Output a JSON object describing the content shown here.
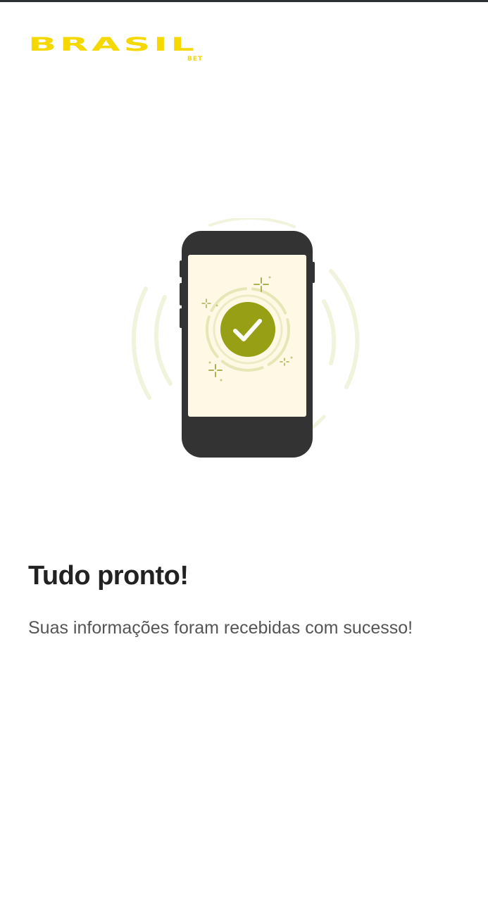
{
  "brand": {
    "logo_text": "BRASIL",
    "logo_sub": "BET",
    "color": "#f5d800"
  },
  "illustration": {
    "icon": "check-icon",
    "accent": "#97a014"
  },
  "success": {
    "title": "Tudo pronto!",
    "message": "Suas informações foram recebidas com sucesso!"
  }
}
